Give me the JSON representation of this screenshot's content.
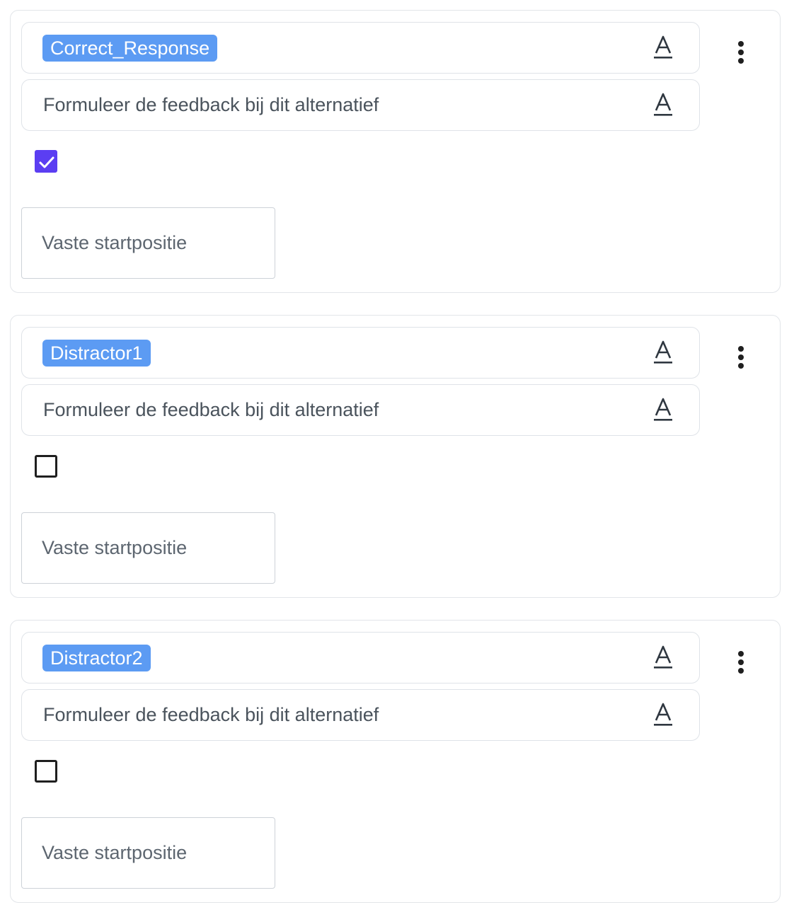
{
  "alternatives": [
    {
      "tag": "Correct_Response",
      "feedback": "Formuleer de feedback bij dit alternatief",
      "checked": true,
      "start_placeholder": "Vaste startpositie"
    },
    {
      "tag": "Distractor1",
      "feedback": "Formuleer de feedback bij dit alternatief",
      "checked": false,
      "start_placeholder": "Vaste startpositie"
    },
    {
      "tag": "Distractor2",
      "feedback": "Formuleer de feedback bij dit alternatief",
      "checked": false,
      "start_placeholder": "Vaste startpositie"
    }
  ],
  "icons": {
    "format": "text-format-icon",
    "menu": "more-vertical-icon",
    "check": "check-icon"
  },
  "colors": {
    "tag_bg": "#5c9bf3",
    "checkbox_checked": "#5b3ef2",
    "text": "#4a535c"
  }
}
